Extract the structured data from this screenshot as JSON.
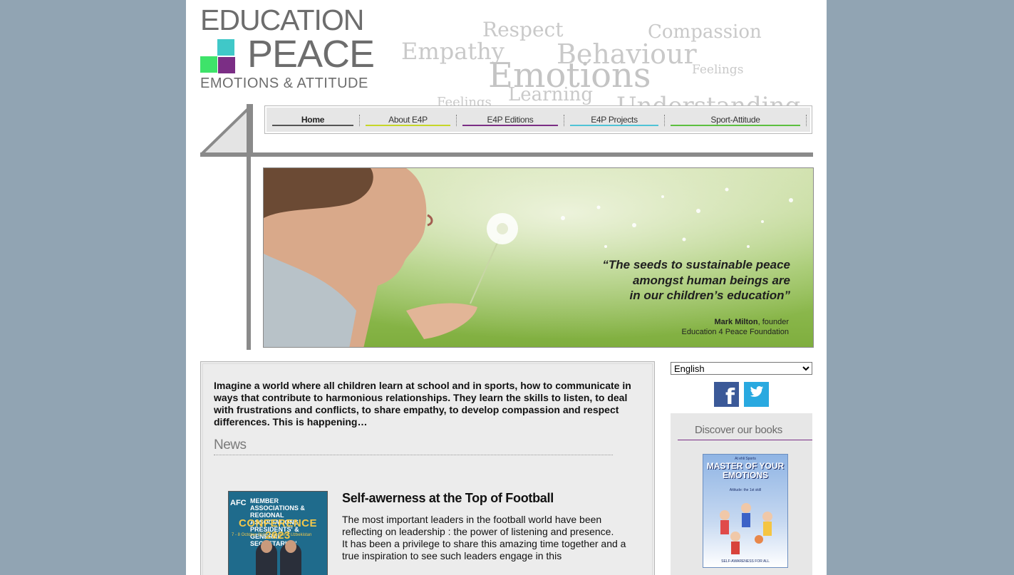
{
  "logo": {
    "line1": "EDUCATION",
    "line2": "PEACE",
    "line3": "EMOTIONS & ATTITUDE"
  },
  "word_cloud": {
    "respect": "Respect",
    "compassion": "Compassion",
    "empathy": "Empathy",
    "behaviour": "Behaviour",
    "emotions": "Emotions",
    "feelings_right": "Feelings",
    "feelings_left": "Feelings",
    "learning": "Learning",
    "understanding": "Understanding"
  },
  "nav": {
    "items": [
      {
        "label": "Home",
        "color": "#555555"
      },
      {
        "label": "About E4P",
        "color": "#c6d628"
      },
      {
        "label": "E4P Editions",
        "color": "#7b2e85"
      },
      {
        "label": "E4P Projects",
        "color": "#4fc3d6"
      },
      {
        "label": "Sport-Attitude",
        "color": "#5cbf3f"
      }
    ]
  },
  "hero": {
    "quote_line1": "“The seeds to sustainable peace",
    "quote_line2": "amongst human beings are",
    "quote_line3": "in our children’s education”",
    "author_name": "Mark Milton",
    "author_role": ", founder",
    "author_org": "Education 4 Peace Foundation"
  },
  "content": {
    "intro": "Imagine a world where all children learn at school and in sports, how to communicate in ways that contribute to harmonious relationships. They learn the skills to listen, to deal with frustrations and conflicts, to share empathy, to develop compassion and respect differences. This is happening…",
    "news_heading": "News",
    "news": {
      "title": "Self-awerness at the Top of Football",
      "body_p1": "The most important leaders in the football world have been reflecting on leadership : the power of listening and presence.",
      "body_p2": "It has been a privilege to share this amazing time together and a true inspiration to see such leaders engage in this",
      "thumb": {
        "afc": "AFC",
        "band": "MEMBER ASSOCIATIONS & REGIONAL ASSOCIATIONS PRESIDENTS' & GENERAL SECRETARIES'",
        "conference": "CONFERENCE 2023",
        "dates": "7 - 8 October 2023 · Tashkent, Uzbekistan"
      }
    }
  },
  "sidebar": {
    "language": "English",
    "facebook_icon": "facebook-icon",
    "twitter_icon": "twitter-icon",
    "books_heading": "Discover our books",
    "book": {
      "top": "At ehli Sports",
      "title": "MASTER OF YOUR EMOTIONS",
      "subtitle": "Attitude: the 1st skill",
      "footer": "SELF-AWARENESS FOR ALL"
    }
  },
  "colors": {
    "background": "#91a4b3",
    "logo_teal": "#40c8c8",
    "logo_green": "#3ee36a",
    "logo_purple": "#7b2e85"
  }
}
